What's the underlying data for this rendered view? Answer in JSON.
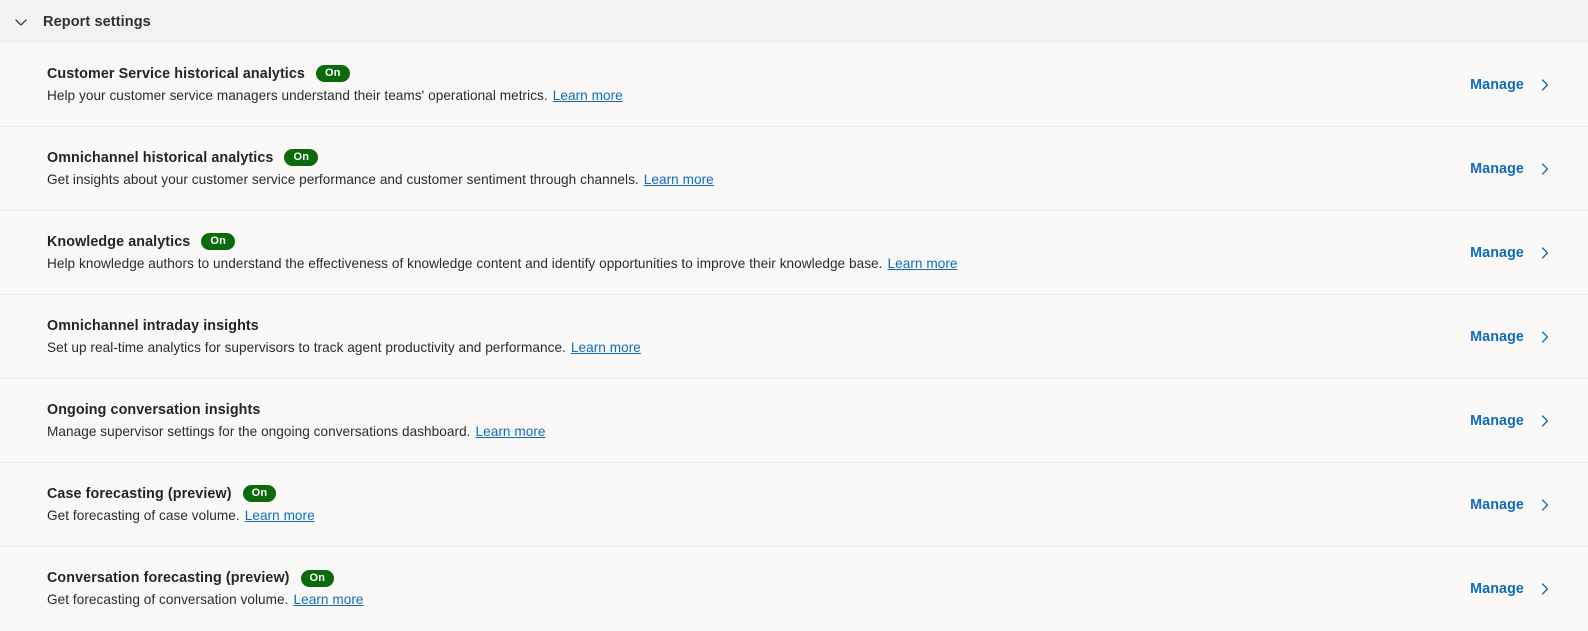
{
  "header": {
    "title": "Report settings",
    "collapse_icon": "chevron-down-icon",
    "expanded": true
  },
  "colors": {
    "header_background": "#f3f2f1",
    "page_background": "#faf9f8",
    "badge_green": "#0b6a0b",
    "link_blue": "#0f6cbd",
    "divider": "#edebe9",
    "text_primary": "#242424"
  },
  "common": {
    "manage_label": "Manage",
    "manage_icon": "chevron-right-icon",
    "learn_more_label": "Learn more",
    "badge_on_label": "On"
  },
  "rows": [
    {
      "title": "Customer Service historical analytics",
      "badge": "On",
      "has_badge": true,
      "description": "Help your customer service managers understand their teams' operational metrics.",
      "learn_more": "Learn more",
      "action": "Manage"
    },
    {
      "title": "Omnichannel historical analytics",
      "badge": "On",
      "has_badge": true,
      "description": "Get insights about your customer service performance and customer sentiment through channels.",
      "learn_more": "Learn more",
      "action": "Manage"
    },
    {
      "title": "Knowledge analytics",
      "badge": "On",
      "has_badge": true,
      "description": "Help knowledge authors to understand the effectiveness of knowledge content and identify opportunities to improve their knowledge base.",
      "learn_more": "Learn more",
      "action": "Manage"
    },
    {
      "title": "Omnichannel intraday insights",
      "badge": "",
      "has_badge": false,
      "description": "Set up real-time analytics for supervisors to track agent productivity and performance.",
      "learn_more": "Learn more",
      "action": "Manage"
    },
    {
      "title": "Ongoing conversation insights",
      "badge": "",
      "has_badge": false,
      "description": "Manage supervisor settings for the ongoing conversations dashboard.",
      "learn_more": "Learn more",
      "action": "Manage"
    },
    {
      "title": "Case forecasting (preview)",
      "badge": "On",
      "has_badge": true,
      "description": "Get forecasting of case volume.",
      "learn_more": "Learn more",
      "action": "Manage"
    },
    {
      "title": "Conversation forecasting (preview)",
      "badge": "On",
      "has_badge": true,
      "description": "Get forecasting of conversation volume.",
      "learn_more": "Learn more",
      "action": "Manage"
    }
  ]
}
